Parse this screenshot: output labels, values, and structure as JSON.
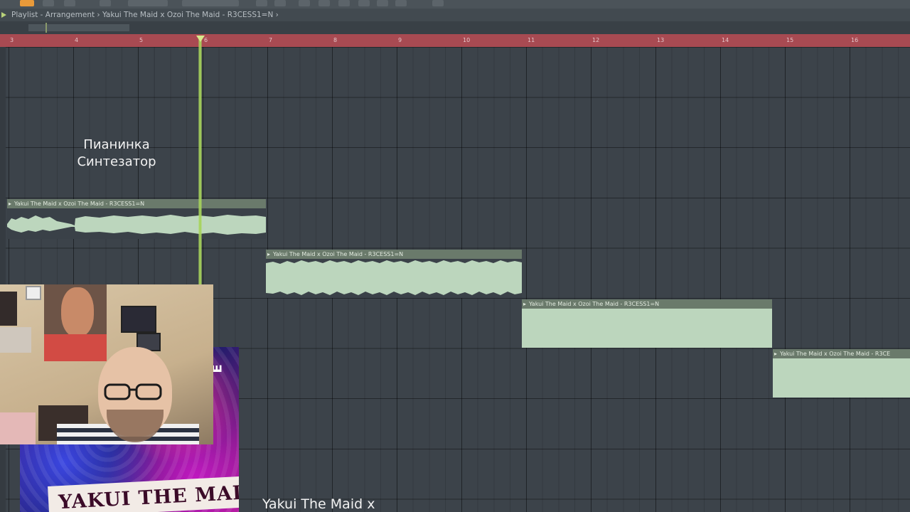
{
  "titlebar": {
    "breadcrumb": "Playlist - Arrangement › Yakui The Maid x Ozoi The Maid - R3CESS1=N ›"
  },
  "ruler": {
    "bars": [
      "3",
      "4",
      "5",
      "6",
      "7",
      "8",
      "9",
      "10",
      "11",
      "12",
      "13",
      "14",
      "15",
      "16"
    ]
  },
  "overlay": {
    "label_line1": "Пианинка",
    "label_line2": "Синтезатор",
    "bottom_text": "Yakui The Maid x"
  },
  "clips": [
    {
      "label": "Yakui The Maid x Ozoi The Maid - R3CESS1=N",
      "waveform": "dense"
    },
    {
      "label": "Yakui The Maid x Ozoi The Maid - R3CESS1=N",
      "waveform": "dense"
    },
    {
      "label": "Yakui The Maid x Ozoi The Maid - R3CESS1=N",
      "waveform": "full"
    },
    {
      "label": "Yakui The Maid x Ozoi The Maid - R3CE",
      "waveform": "full"
    }
  ],
  "album": {
    "title": "YAKUI THE MAID",
    "side_text": "E"
  },
  "colors": {
    "ruler": "#a84a52",
    "playhead": "#a6d35a",
    "clip_body": "#bcd6bd",
    "clip_header": "#6a7a6b",
    "grid": "#3c434a"
  }
}
